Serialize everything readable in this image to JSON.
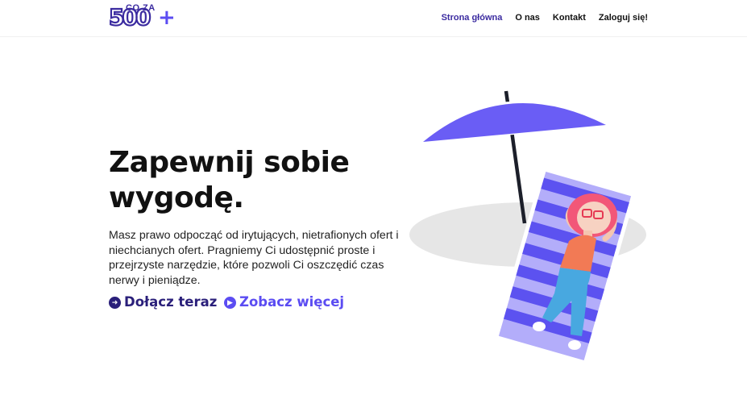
{
  "logo": {
    "number": "500",
    "small_text": "CO ZA",
    "plus": "+"
  },
  "nav": {
    "items": [
      {
        "label": "Strona główna",
        "active": true
      },
      {
        "label": "O nas",
        "active": false
      },
      {
        "label": "Kontakt",
        "active": false
      },
      {
        "label": "Zaloguj się!",
        "active": false
      }
    ]
  },
  "hero": {
    "title": "Zapewnij sobie wygodę.",
    "text": "Masz prawo odpocząć od irytujących, nietrafionych ofert i niechcianych ofert. Pragniemy Ci udostępnić proste i przejrzyste narzędzie, które pozwoli Ci oszczędić czas nerwy i pieniądze.",
    "cta_join": "Dołącz teraz",
    "cta_more": "Zobacz więcej"
  },
  "colors": {
    "brand_dark": "#2a1f7a",
    "brand": "#3b2ba0",
    "accent": "#5b4cf2",
    "text": "#111111"
  },
  "icons": {
    "cta_join_icon": "arrow-right-circle-icon",
    "cta_more_icon": "play-circle-icon"
  }
}
